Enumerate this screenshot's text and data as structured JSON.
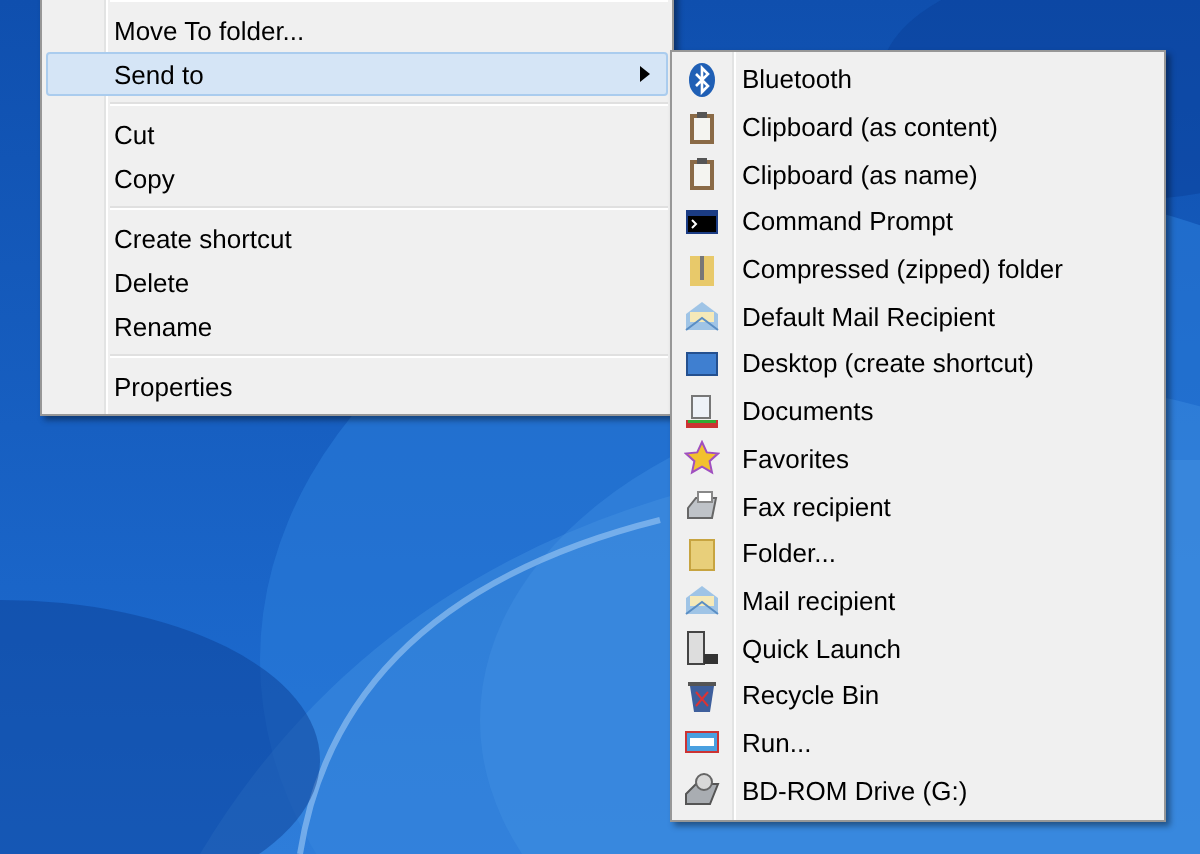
{
  "context_menu": {
    "items": [
      {
        "kind": "separator"
      },
      {
        "kind": "item",
        "label": "Move To folder...",
        "selected": false,
        "submenu": false
      },
      {
        "kind": "item",
        "label": "Send to",
        "selected": true,
        "submenu": true
      },
      {
        "kind": "separator"
      },
      {
        "kind": "item",
        "label": "Cut",
        "selected": false,
        "submenu": false
      },
      {
        "kind": "item",
        "label": "Copy",
        "selected": false,
        "submenu": false
      },
      {
        "kind": "separator"
      },
      {
        "kind": "item",
        "label": "Create shortcut",
        "selected": false,
        "submenu": false
      },
      {
        "kind": "item",
        "label": "Delete",
        "selected": false,
        "submenu": false
      },
      {
        "kind": "item",
        "label": "Rename",
        "selected": false,
        "submenu": false
      },
      {
        "kind": "separator"
      },
      {
        "kind": "item",
        "label": "Properties",
        "selected": false,
        "submenu": false
      }
    ]
  },
  "send_to_menu": {
    "items": [
      {
        "kind": "bluetooth",
        "label": "Bluetooth"
      },
      {
        "kind": "clipboard",
        "label": "Clipboard (as content)"
      },
      {
        "kind": "clipboard",
        "label": "Clipboard (as name)"
      },
      {
        "kind": "console",
        "label": "Command Prompt"
      },
      {
        "kind": "zip",
        "label": "Compressed (zipped) folder"
      },
      {
        "kind": "mail",
        "label": "Default Mail Recipient"
      },
      {
        "kind": "desktop",
        "label": "Desktop (create shortcut)"
      },
      {
        "kind": "documents",
        "label": "Documents"
      },
      {
        "kind": "star",
        "label": "Favorites"
      },
      {
        "kind": "fax",
        "label": "Fax recipient"
      },
      {
        "kind": "folder",
        "label": "Folder..."
      },
      {
        "kind": "mail",
        "label": "Mail recipient"
      },
      {
        "kind": "launch",
        "label": "Quick Launch"
      },
      {
        "kind": "recycle",
        "label": "Recycle Bin"
      },
      {
        "kind": "run",
        "label": "Run..."
      },
      {
        "kind": "drive",
        "label": "BD-ROM Drive (G:)"
      }
    ]
  }
}
